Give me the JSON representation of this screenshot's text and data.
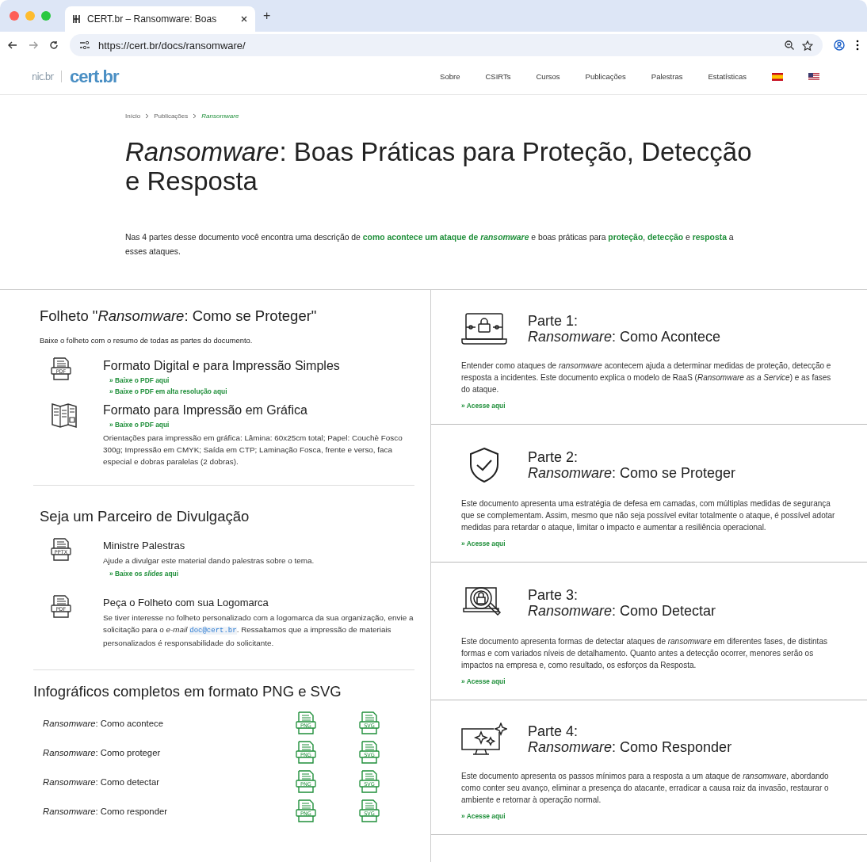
{
  "browser": {
    "tab_title": "CERT.br – Ransomware: Boas",
    "new_tab": "+",
    "url": "https://cert.br/docs/ransomware/"
  },
  "site_header": {
    "logo_left": "nic.br",
    "logo_right": "cert.br",
    "nav": [
      "Sobre",
      "CSIRTs",
      "Cursos",
      "Publicações",
      "Palestras",
      "Estatísticas"
    ],
    "languages": [
      {
        "kind": "spain"
      },
      {
        "kind": "usa"
      }
    ]
  },
  "breadcrumb": [
    {
      "label": "Início",
      "current": false
    },
    {
      "label": "Publicações",
      "current": false
    },
    {
      "label": "Ransomware",
      "current": true
    }
  ],
  "title": "*Ransomware*: Boas Práticas para Proteção, Detecção e Resposta",
  "intro": "Nas 4 partes desse documento você encontra uma descrição de **como acontece um ataque de** *ransomware* e boas práticas para **proteção**, **detecção** e **resposta** a esses ataques.",
  "brochure": {
    "heading": "Folheto \"*Ransomware*: Como se Proteger\"",
    "subtitle": "Baixe o folheto com o resumo de todas as partes do documento.",
    "formats": [
      {
        "kind": "file",
        "icon_label": "PDF",
        "title": "Formato Digital e para Impressão Simples",
        "links": [
          "» Baixe o PDF aqui",
          "» Baixe o PDF em alta resolução aqui"
        ]
      },
      {
        "kind": "folded",
        "title": "Formato para Impressão em Gráfica",
        "links": [
          "» Baixe o PDF aqui"
        ],
        "note": "Orientações para impressão em gráfica: Lâmina: 60x25cm total; Papel: Couchè Fosco 300g; Impressão em CMYK; Saída em CTP; Laminação Fosca, frente e verso, faca especial e dobras paralelas (2 dobras)."
      }
    ]
  },
  "partner": {
    "heading": "Seja um Parceiro de Divulgação",
    "items": [
      {
        "icon_label": "PPTX",
        "title": "Ministre Palestras",
        "text": "Ajude a divulgar este material dando palestras sobre o tema.",
        "link": "» Baixe os *slides* aqui"
      },
      {
        "icon_label": "PDF",
        "title": "Peça o Folheto com sua Logomarca",
        "text_before": "Se tiver interesse no folheto personalizado com a logomarca da sua organização, envie a solicitação para o *e-mail*",
        "email": "doc@cert.br",
        "text_after": ". Ressaltamos que a impressão de materiais personalizados é responsabilidade do solicitante."
      }
    ]
  },
  "infographics": {
    "heading": "Infográficos completos em formato PNG e SVG",
    "rows": [
      {
        "name": "*Ransomware*: Como acontece",
        "png": "PNG",
        "svg": "SVG"
      },
      {
        "name": "*Ransomware*: Como proteger",
        "png": "PNG",
        "svg": "SVG"
      },
      {
        "name": "*Ransomware*: Como detectar",
        "png": "PNG",
        "svg": "SVG"
      },
      {
        "name": "*Ransomware*: Como responder",
        "png": "PNG",
        "svg": "SVG"
      }
    ]
  },
  "parts": [
    {
      "kind": "laptop-lock",
      "label": "Parte 1:",
      "title": "*Ransomware*: Como Acontece",
      "text": "Entender como ataques de *ransomware* acontecem ajuda a determinar medidas de proteção, detecção e resposta a incidentes. Este documento explica o modelo de RaaS (*Ransomware as a Service*) e as fases do ataque.",
      "link": "» Acesse aqui"
    },
    {
      "kind": "shield",
      "label": "Parte 2:",
      "title": "*Ransomware*: Como se Proteger",
      "text": "Este documento apresenta uma estratégia de defesa em camadas, com múltiplas medidas de segurança que se complementam. Assim, mesmo que não seja possível evitar totalmente o ataque, é possível adotar medidas para retardar o ataque, limitar o impacto e aumentar a resiliência operacional.",
      "link": "» Acesse aqui"
    },
    {
      "kind": "laptop-search",
      "label": "Parte 3:",
      "title": "*Ransomware*: Como Detectar",
      "text": "Este documento apresenta formas de detectar ataques de *ransomware* em diferentes fases, de distintas formas e com variados níveis de detalhamento. Quanto antes a detecção ocorrer, menores serão os impactos na empresa e, como resultado, os esforços da Resposta.",
      "link": "» Acesse aqui"
    },
    {
      "kind": "monitor-sparkle",
      "label": "Parte 4:",
      "title": "*Ransomware*: Como Responder",
      "text": "Este documento apresenta os passos mínimos para a resposta a um ataque de *ransomware*, abordando como conter seu avanço, eliminar a presença do atacante, erradicar a causa raiz da invasão, restaurar o ambiente e retornar à operação normal.",
      "link": "» Acesse aqui"
    }
  ]
}
